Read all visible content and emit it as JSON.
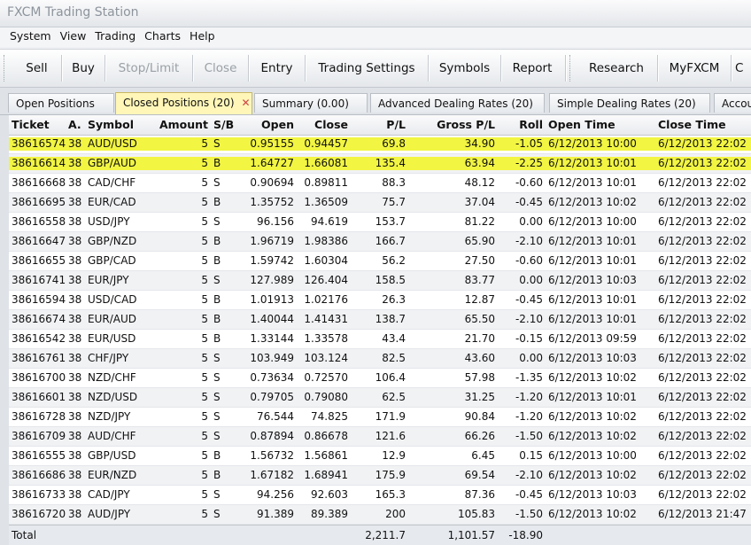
{
  "window": {
    "title": "FXCM Trading Station"
  },
  "menu": [
    "System",
    "View",
    "Trading",
    "Charts",
    "Help"
  ],
  "toolbar": {
    "sell": "Sell",
    "buy": "Buy",
    "stop_limit": "Stop/Limit",
    "close": "Close",
    "entry": "Entry",
    "trading_settings": "Trading Settings",
    "symbols": "Symbols",
    "report": "Report",
    "research": "Research",
    "myfxcm": "MyFXCM",
    "more": "C"
  },
  "tabs": [
    {
      "label": "Open Positions"
    },
    {
      "label": "Closed Positions (20)"
    },
    {
      "label": "Summary (0.00)"
    },
    {
      "label": "Advanced Dealing Rates (20)"
    },
    {
      "label": "Simple Dealing Rates (20)"
    },
    {
      "label": "Accou"
    }
  ],
  "columns": [
    "Ticket",
    "A.",
    "Symbol",
    "Amount",
    "S/B",
    "Open",
    "Close",
    "P/L",
    "Gross P/L",
    "Roll",
    "Open Time",
    "Close Time"
  ],
  "rows": [
    [
      "38616574",
      "38",
      "AUD/USD",
      "5",
      "S",
      "0.95155",
      "0.94457",
      "69.8",
      "34.90",
      "-1.05",
      "6/12/2013 10:00",
      "6/12/2013 22:02"
    ],
    [
      "38616614",
      "38",
      "GBP/AUD",
      "5",
      "B",
      "1.64727",
      "1.66081",
      "135.4",
      "63.94",
      "-2.25",
      "6/12/2013 10:01",
      "6/12/2013 22:02"
    ],
    [
      "38616668",
      "38",
      "CAD/CHF",
      "5",
      "S",
      "0.90694",
      "0.89811",
      "88.3",
      "48.12",
      "-0.60",
      "6/12/2013 10:01",
      "6/12/2013 22:02"
    ],
    [
      "38616695",
      "38",
      "EUR/CAD",
      "5",
      "B",
      "1.35752",
      "1.36509",
      "75.7",
      "37.04",
      "-0.45",
      "6/12/2013 10:02",
      "6/12/2013 22:02"
    ],
    [
      "38616558",
      "38",
      "USD/JPY",
      "5",
      "S",
      "96.156",
      "94.619",
      "153.7",
      "81.22",
      "0.00",
      "6/12/2013 10:00",
      "6/12/2013 22:02"
    ],
    [
      "38616647",
      "38",
      "GBP/NZD",
      "5",
      "B",
      "1.96719",
      "1.98386",
      "166.7",
      "65.90",
      "-2.10",
      "6/12/2013 10:01",
      "6/12/2013 22:02"
    ],
    [
      "38616655",
      "38",
      "GBP/CAD",
      "5",
      "B",
      "1.59742",
      "1.60304",
      "56.2",
      "27.50",
      "-0.60",
      "6/12/2013 10:01",
      "6/12/2013 22:02"
    ],
    [
      "38616741",
      "38",
      "EUR/JPY",
      "5",
      "S",
      "127.989",
      "126.404",
      "158.5",
      "83.77",
      "0.00",
      "6/12/2013 10:03",
      "6/12/2013 22:02"
    ],
    [
      "38616594",
      "38",
      "USD/CAD",
      "5",
      "B",
      "1.01913",
      "1.02176",
      "26.3",
      "12.87",
      "-0.45",
      "6/12/2013 10:01",
      "6/12/2013 22:02"
    ],
    [
      "38616674",
      "38",
      "EUR/AUD",
      "5",
      "B",
      "1.40044",
      "1.41431",
      "138.7",
      "65.50",
      "-2.10",
      "6/12/2013 10:01",
      "6/12/2013 22:02"
    ],
    [
      "38616542",
      "38",
      "EUR/USD",
      "5",
      "B",
      "1.33144",
      "1.33578",
      "43.4",
      "21.70",
      "-0.15",
      "6/12/2013 09:59",
      "6/12/2013 22:02"
    ],
    [
      "38616761",
      "38",
      "CHF/JPY",
      "5",
      "S",
      "103.949",
      "103.124",
      "82.5",
      "43.60",
      "0.00",
      "6/12/2013 10:03",
      "6/12/2013 22:02"
    ],
    [
      "38616700",
      "38",
      "NZD/CHF",
      "5",
      "S",
      "0.73634",
      "0.72570",
      "106.4",
      "57.98",
      "-1.35",
      "6/12/2013 10:02",
      "6/12/2013 22:02"
    ],
    [
      "38616601",
      "38",
      "NZD/USD",
      "5",
      "S",
      "0.79705",
      "0.79080",
      "62.5",
      "31.25",
      "-1.20",
      "6/12/2013 10:01",
      "6/12/2013 22:02"
    ],
    [
      "38616728",
      "38",
      "NZD/JPY",
      "5",
      "S",
      "76.544",
      "74.825",
      "171.9",
      "90.84",
      "-1.20",
      "6/12/2013 10:02",
      "6/12/2013 22:02"
    ],
    [
      "38616709",
      "38",
      "AUD/CHF",
      "5",
      "S",
      "0.87894",
      "0.86678",
      "121.6",
      "66.26",
      "-1.50",
      "6/12/2013 10:02",
      "6/12/2013 22:02"
    ],
    [
      "38616555",
      "38",
      "GBP/USD",
      "5",
      "B",
      "1.56732",
      "1.56861",
      "12.9",
      "6.45",
      "0.15",
      "6/12/2013 10:00",
      "6/12/2013 22:02"
    ],
    [
      "38616686",
      "38",
      "EUR/NZD",
      "5",
      "B",
      "1.67182",
      "1.68941",
      "175.9",
      "69.54",
      "-2.10",
      "6/12/2013 10:02",
      "6/12/2013 22:02"
    ],
    [
      "38616733",
      "38",
      "CAD/JPY",
      "5",
      "S",
      "94.256",
      "92.603",
      "165.3",
      "87.36",
      "-0.45",
      "6/12/2013 10:03",
      "6/12/2013 22:02"
    ],
    [
      "38616720",
      "38",
      "AUD/JPY",
      "5",
      "S",
      "91.389",
      "89.389",
      "200",
      "105.83",
      "-1.50",
      "6/12/2013 10:02",
      "6/12/2013 21:47"
    ]
  ],
  "highlighted_rows": [
    0,
    1
  ],
  "highlight_color": "#f2f542",
  "total": {
    "label": "Total",
    "pl": "2,211.7",
    "gross_pl": "1,101.57",
    "roll": "-18.90"
  },
  "colors": {
    "active_tab": "#fff6b8",
    "row_alt": "#f1f2f4"
  }
}
